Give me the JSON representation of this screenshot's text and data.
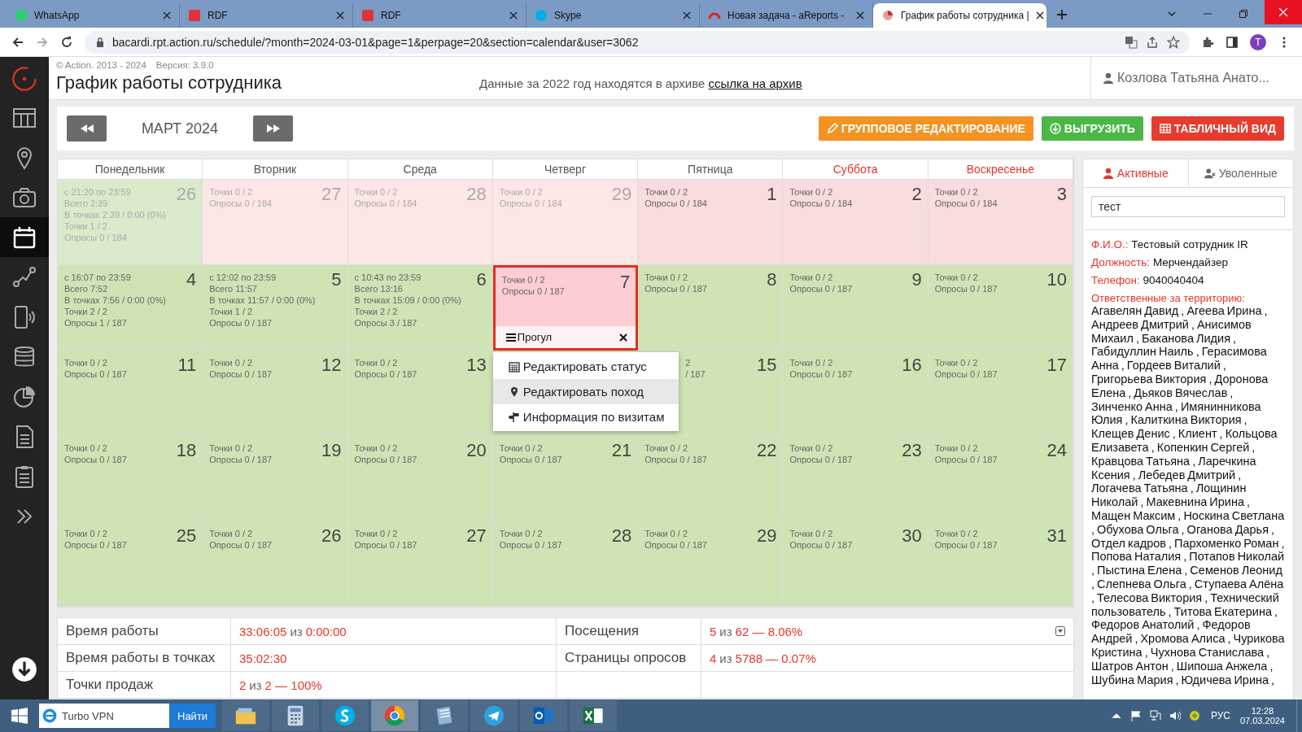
{
  "browser": {
    "tabs": [
      {
        "title": "WhatsApp",
        "selected": false
      },
      {
        "title": "RDF",
        "selected": false
      },
      {
        "title": "RDF",
        "selected": false
      },
      {
        "title": "Skype",
        "selected": false
      },
      {
        "title": "Новая задача - aReports -",
        "selected": false
      },
      {
        "title": "График работы сотрудника |",
        "selected": true
      }
    ],
    "url": "bacardi.rpt.action.ru/schedule/?month=2024-03-01&page=1&perpage=20&section=calendar&user=3062",
    "profile": "T"
  },
  "sidebar": {
    "items": [
      {
        "selected": false
      },
      {
        "selected": false
      },
      {
        "selected": false
      },
      {
        "selected": true
      },
      {
        "selected": false
      },
      {
        "selected": false
      },
      {
        "selected": false
      },
      {
        "selected": false
      },
      {
        "selected": false
      },
      {
        "selected": false
      },
      {
        "selected": false
      }
    ]
  },
  "header": {
    "copyright": "© Action. 2013 - 2024",
    "version": "Версия: 3.9.0",
    "title": "График работы сотрудника",
    "notice": "Данные за 2022 год находятся в архиве",
    "archive_link": "ссылка на архив",
    "user": "Козлова Татьяна Анато..."
  },
  "toolbar": {
    "month": "МАРТ 2024",
    "buttons": [
      {
        "label": "ГРУППОВОЕ РЕДАКТИРОВАНИЕ",
        "kind": "edit"
      },
      {
        "label": "ВЫГРУЗИТЬ",
        "kind": "export"
      },
      {
        "label": "ТАБЛИЧНЫЙ ВИД",
        "kind": "table"
      }
    ]
  },
  "calendar": {
    "weekdays": [
      {
        "name": "Понедельник",
        "weekend": false
      },
      {
        "name": "Вторник",
        "weekend": false
      },
      {
        "name": "Среда",
        "weekend": false
      },
      {
        "name": "Четверг",
        "weekend": false
      },
      {
        "name": "Пятница",
        "weekend": false
      },
      {
        "name": "Суббота",
        "weekend": true
      },
      {
        "name": "Воскресенье",
        "weekend": true
      }
    ],
    "days": [
      {
        "day": "26",
        "in_month": false,
        "absent": false,
        "selected": false,
        "lines": [
          "с 21:20 по 23:59",
          "Всего 2:39",
          "В точках 2:39 / 0:00 (0%)",
          "Точки 1 / 2",
          "Опросы 0 / 184"
        ]
      },
      {
        "day": "27",
        "in_month": false,
        "absent": true,
        "selected": false,
        "lines": [
          "Точки 0 / 2",
          "Опросы 0 / 184"
        ]
      },
      {
        "day": "28",
        "in_month": false,
        "absent": true,
        "selected": false,
        "lines": [
          "Точки 0 / 2",
          "Опросы 0 / 184"
        ]
      },
      {
        "day": "29",
        "in_month": false,
        "absent": true,
        "selected": false,
        "lines": [
          "Точки 0 / 2",
          "Опросы 0 / 184"
        ]
      },
      {
        "day": "1",
        "in_month": true,
        "absent": true,
        "selected": false,
        "lines": [
          "Точки 0 / 2",
          "Опросы 0 / 184"
        ]
      },
      {
        "day": "2",
        "in_month": true,
        "absent": true,
        "selected": false,
        "lines": [
          "Точки 0 / 2",
          "Опросы 0 / 184"
        ]
      },
      {
        "day": "3",
        "in_month": true,
        "absent": true,
        "selected": false,
        "lines": [
          "Точки 0 / 2",
          "Опросы 0 / 184"
        ]
      },
      {
        "day": "4",
        "in_month": true,
        "absent": false,
        "selected": false,
        "lines": [
          "с 16:07 по 23:59",
          "Всего 7:52",
          "В точках 7:56 / 0:00 (0%)",
          "Точки 2 / 2",
          "Опросы 1 / 187"
        ]
      },
      {
        "day": "5",
        "in_month": true,
        "absent": false,
        "selected": false,
        "lines": [
          "с 12:02 по 23:59",
          "Всего 11:57",
          "В точках 11:57 / 0:00 (0%)",
          "Точки 1 / 2",
          "Опросы 0 / 187"
        ]
      },
      {
        "day": "6",
        "in_month": true,
        "absent": false,
        "selected": false,
        "lines": [
          "с 10:43 по 23:59",
          "Всего 13:16",
          "В точках 15:09 / 0:00 (0%)",
          "Точки 2 / 2",
          "Опросы 3 / 187"
        ]
      },
      {
        "day": "7",
        "in_month": true,
        "absent": true,
        "selected": true,
        "lines": [
          "Точки 0 / 2",
          "Опросы 0 / 187"
        ],
        "mark": "Прогул"
      },
      {
        "day": "8",
        "in_month": true,
        "absent": false,
        "selected": false,
        "lines": [
          "Точки 0 / 2",
          "Опросы 0 / 187"
        ]
      },
      {
        "day": "9",
        "in_month": true,
        "absent": false,
        "selected": false,
        "lines": [
          "Точки 0 / 2",
          "Опросы 0 / 187"
        ]
      },
      {
        "day": "10",
        "in_month": true,
        "absent": false,
        "selected": false,
        "lines": [
          "Точки 0 / 2",
          "Опросы 0 / 187"
        ]
      },
      {
        "day": "11",
        "in_month": true,
        "absent": false,
        "selected": false,
        "lines": [
          "Точки 0 / 2",
          "Опросы 0 / 187"
        ]
      },
      {
        "day": "12",
        "in_month": true,
        "absent": false,
        "selected": false,
        "lines": [
          "Точки 0 / 2",
          "Опросы 0 / 187"
        ]
      },
      {
        "day": "13",
        "in_month": true,
        "absent": false,
        "selected": false,
        "lines": [
          "Точки 0 / 2",
          "Опросы 0 / 187"
        ]
      },
      {
        "in_month": true,
        "absent": false,
        "selected": false
      },
      {
        "day": "15",
        "in_month": true,
        "absent": false,
        "selected": false,
        "covered": true,
        "lines": [
          "2",
          "/ 187"
        ]
      },
      {
        "day": "16",
        "in_month": true,
        "absent": false,
        "selected": false,
        "lines": [
          "Точки 0 / 2",
          "Опросы 0 / 187"
        ]
      },
      {
        "day": "17",
        "in_month": true,
        "absent": false,
        "selected": false,
        "lines": [
          "Точки 0 / 2",
          "Опросы 0 / 187"
        ]
      },
      {
        "day": "18",
        "in_month": true,
        "absent": false,
        "selected": false,
        "lines": [
          "Точки 0 / 2",
          "Опросы 0 / 187"
        ]
      },
      {
        "day": "19",
        "in_month": true,
        "absent": false,
        "selected": false,
        "lines": [
          "Точки 0 / 2",
          "Опросы 0 / 187"
        ]
      },
      {
        "day": "20",
        "in_month": true,
        "absent": false,
        "selected": false,
        "lines": [
          "Точки 0 / 2",
          "Опросы 0 / 187"
        ]
      },
      {
        "day": "21",
        "in_month": true,
        "absent": false,
        "selected": false,
        "lines": [
          "Точки 0 / 2",
          "Опросы 0 / 187"
        ]
      },
      {
        "day": "22",
        "in_month": true,
        "absent": false,
        "selected": false,
        "lines": [
          "Точки 0 / 2",
          "Опросы 0 / 187"
        ]
      },
      {
        "day": "23",
        "in_month": true,
        "absent": false,
        "selected": false,
        "lines": [
          "Точки 0 / 2",
          "Опросы 0 / 187"
        ]
      },
      {
        "day": "24",
        "in_month": true,
        "absent": false,
        "selected": false,
        "lines": [
          "Точки 0 / 2",
          "Опросы 0 / 187"
        ]
      },
      {
        "day": "25",
        "in_month": true,
        "absent": false,
        "selected": false,
        "lines": [
          "Точки 0 / 2",
          "Опросы 0 / 187"
        ]
      },
      {
        "day": "26",
        "in_month": true,
        "absent": false,
        "selected": false,
        "lines": [
          "Точки 0 / 2",
          "Опросы 0 / 187"
        ]
      },
      {
        "day": "27",
        "in_month": true,
        "absent": false,
        "selected": false,
        "lines": [
          "Точки 0 / 2",
          "Опросы 0 / 187"
        ]
      },
      {
        "day": "28",
        "in_month": true,
        "absent": false,
        "selected": false,
        "lines": [
          "Точки 0 / 2",
          "Опросы 0 / 187"
        ]
      },
      {
        "day": "29",
        "in_month": true,
        "absent": false,
        "selected": false,
        "lines": [
          "Точки 0 / 2",
          "Опросы 0 / 187"
        ]
      },
      {
        "day": "30",
        "in_month": true,
        "absent": false,
        "selected": false,
        "lines": [
          "Точки 0 / 2",
          "Опросы 0 / 187"
        ]
      },
      {
        "day": "31",
        "in_month": true,
        "absent": false,
        "selected": false,
        "lines": [
          "Точки 0 / 2",
          "Опросы 0 / 187"
        ]
      }
    ],
    "context_menu": [
      {
        "label": "Редактировать статус",
        "selected": false
      },
      {
        "label": "Редактировать поход",
        "selected": true
      },
      {
        "label": "Информация по визитам",
        "selected": false
      }
    ]
  },
  "stats": [
    {
      "label": "Время работы",
      "value": [
        {
          "text": "33:06:05",
          "accent": true
        },
        {
          "text": "из",
          "accent": false
        },
        {
          "text": "0:00:00",
          "accent": true
        }
      ],
      "label2": "Посещения",
      "value2": [
        {
          "text": "5",
          "accent": true
        },
        {
          "text": "из",
          "accent": false
        },
        {
          "text": "62 — 8.06%",
          "accent": true
        }
      ]
    },
    {
      "label": "Время работы в точках",
      "value": [
        {
          "text": "35:02:30",
          "accent": true
        }
      ],
      "label2": "Страницы опросов",
      "value2": [
        {
          "text": "4",
          "accent": true
        },
        {
          "text": "из",
          "accent": false
        },
        {
          "text": "5788 — 0.07%",
          "accent": true
        }
      ]
    },
    {
      "label": "Точки продаж",
      "value": [
        {
          "text": "2",
          "accent": true
        },
        {
          "text": "из",
          "accent": false
        },
        {
          "text": "2 — 100%",
          "accent": true
        }
      ]
    }
  ],
  "employees": {
    "tabs": [
      {
        "label": "Активные",
        "selected": true
      },
      {
        "label": "Уволенные",
        "selected": false
      }
    ],
    "search": "тест",
    "fields": [
      {
        "label": "Ф.И.О.:",
        "value": "Тестовый сотрудник IR"
      },
      {
        "label": "Должность:",
        "value": "Мерчендайзер"
      },
      {
        "label": "Телефон:",
        "value": "9040040404"
      }
    ],
    "responsible_label": "Ответственные за территорию:",
    "responsible": "Агавелян Давид , Агеева Ирина , Андреев Дмитрий , Анисимов Михаил , Баканова Лидия , Габидуллин Наиль , Герасимова Анна , Гордеев Виталий , Григорьева Виктория , Доронова Елена , Дьяков Вячеслав , Зинченко Анна , Имянинникова Юлия , Калиткина Виктория , Клещев Денис , Клиент , Кольцова Елизавета , Копенкин Сергей , Кравцова Татьяна , Ларечкина Ксения , Лебедев Дмитрий , Логачева Татьяна , Лощинин Николай , Макевнина Ирина , Мащен Максим , Носкина Светлана , Обухова Ольга , Оганова Дарья , Отдел кадров , Пархоменко Роман , Попова Наталия , Потапов Николай , Пыстина Елена , Семенов Леонид , Слепнева Ольга , Ступаева Алёна , Телесова Виктория , Технический пользователь , Титова Екатерина , Федоров Анатолий , Федоров Андрей , Хромова Алиса , Чурикова Кристина , Чухнова Станислава , Шатров Антон , Шипоша Анжела , Шубина Мария , Юдичева Ирина ,"
  },
  "taskbar": {
    "search": "Turbo VPN",
    "search_button": "Найти",
    "apps": [
      {
        "selected": false
      },
      {
        "selected": false
      },
      {
        "selected": false
      },
      {
        "selected": true
      },
      {
        "selected": false
      },
      {
        "selected": false
      },
      {
        "selected": false
      },
      {
        "selected": false
      }
    ],
    "language": "РУС",
    "time": "12:28",
    "date": "07.03.2024"
  }
}
